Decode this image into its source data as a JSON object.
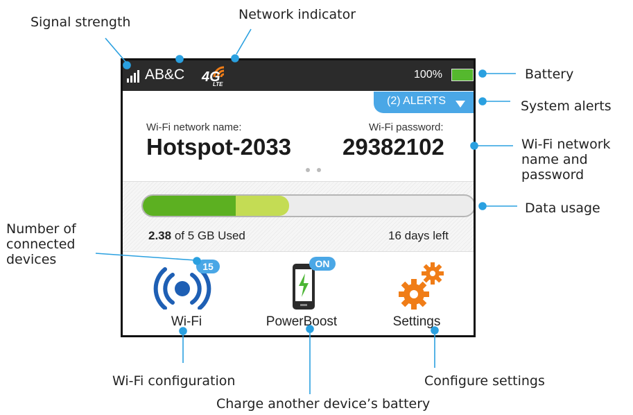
{
  "callouts": {
    "signal_strength": "Signal strength",
    "network_indicator": "Network indicator",
    "battery": "Battery",
    "system_alerts": "System alerts",
    "wifi_credentials": "Wi-Fi network name and password",
    "data_usage": "Data usage",
    "connected_devices": "Number of connected devices",
    "wifi_configuration": "Wi-Fi configuration",
    "charge_battery": "Charge another device’s battery",
    "configure_settings": "Configure settings"
  },
  "status_bar": {
    "carrier": "AB&C",
    "network": "4G",
    "network_sub": "LTE",
    "network_icon": "4g-lte-icon",
    "signal_icon": "signal-bars-icon",
    "battery_percent": "100%",
    "battery_level": 1.0,
    "battery_color": "#55b82e"
  },
  "alerts": {
    "label": "(2) ALERTS",
    "icon": "caret-down-icon",
    "color": "#4aa7e6"
  },
  "wifi": {
    "network_label": "Wi-Fi network name:",
    "network_name": "Hotspot-2033",
    "password_label": "Wi-Fi password:",
    "password": "29382102"
  },
  "usage": {
    "used": "2.38",
    "used_suffix": " of 5 GB Used",
    "days_left": "16 days left",
    "used_fraction": 0.281,
    "projected_fraction": 0.441,
    "used_color": "#5cb021",
    "projected_color": "#c4dc54"
  },
  "tiles": {
    "wifi": {
      "label": "Wi-Fi",
      "badge": "15",
      "icon": "wifi-broadcast-icon"
    },
    "powerboost": {
      "label": "PowerBoost",
      "badge": "ON",
      "icon": "phone-charge-icon"
    },
    "settings": {
      "label": "Settings",
      "icon": "gears-icon"
    }
  },
  "accent_color": "#4aa7e6",
  "icon_color_wifi": "#1e5fb4",
  "icon_color_settings": "#f07d17"
}
